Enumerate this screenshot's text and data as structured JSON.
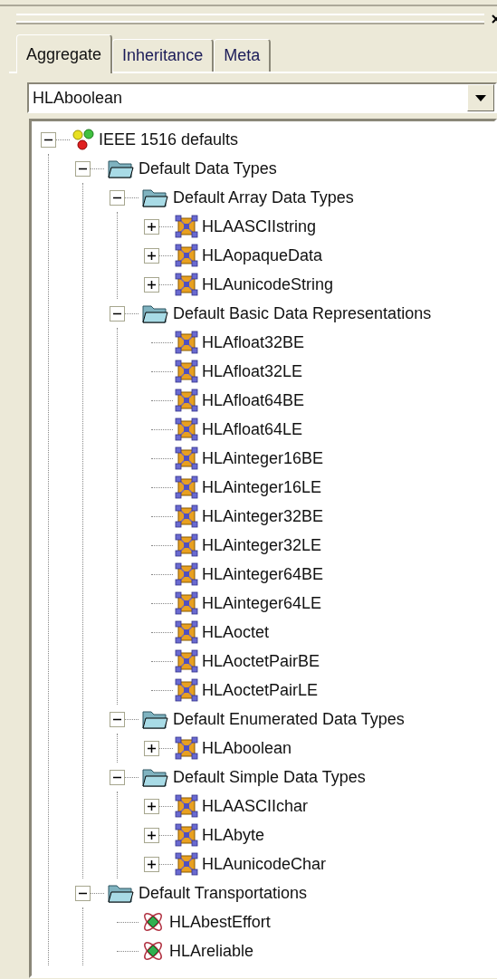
{
  "tabs": [
    {
      "label": "Aggregate",
      "selected": true
    },
    {
      "label": "Inheritance",
      "selected": false
    },
    {
      "label": "Meta",
      "selected": false
    }
  ],
  "dropdown": {
    "value": "HLAboolean"
  },
  "tree": [
    {
      "label": "IEEE 1516 defaults",
      "kind": "root",
      "expanded": true,
      "children": [
        {
          "label": "Default Data Types",
          "kind": "folder",
          "expanded": true,
          "children": [
            {
              "label": "Default Array Data Types",
              "kind": "folder",
              "expanded": true,
              "children": [
                {
                  "label": "HLAASCIIstring",
                  "kind": "datatype",
                  "expanded": false
                },
                {
                  "label": "HLAopaqueData",
                  "kind": "datatype",
                  "expanded": false
                },
                {
                  "label": "HLAunicodeString",
                  "kind": "datatype",
                  "expanded": false
                }
              ]
            },
            {
              "label": "Default Basic Data Representations",
              "kind": "folder",
              "expanded": true,
              "children": [
                {
                  "label": "HLAfloat32BE",
                  "kind": "datatype"
                },
                {
                  "label": "HLAfloat32LE",
                  "kind": "datatype"
                },
                {
                  "label": "HLAfloat64BE",
                  "kind": "datatype"
                },
                {
                  "label": "HLAfloat64LE",
                  "kind": "datatype"
                },
                {
                  "label": "HLAinteger16BE",
                  "kind": "datatype"
                },
                {
                  "label": "HLAinteger16LE",
                  "kind": "datatype"
                },
                {
                  "label": "HLAinteger32BE",
                  "kind": "datatype"
                },
                {
                  "label": "HLAinteger32LE",
                  "kind": "datatype"
                },
                {
                  "label": "HLAinteger64BE",
                  "kind": "datatype"
                },
                {
                  "label": "HLAinteger64LE",
                  "kind": "datatype"
                },
                {
                  "label": "HLAoctet",
                  "kind": "datatype"
                },
                {
                  "label": "HLAoctetPairBE",
                  "kind": "datatype"
                },
                {
                  "label": "HLAoctetPairLE",
                  "kind": "datatype"
                }
              ]
            },
            {
              "label": "Default Enumerated Data Types",
              "kind": "folder",
              "expanded": true,
              "children": [
                {
                  "label": "HLAboolean",
                  "kind": "datatype",
                  "expanded": false
                }
              ]
            },
            {
              "label": "Default Simple Data Types",
              "kind": "folder",
              "expanded": true,
              "children": [
                {
                  "label": "HLAASCIIchar",
                  "kind": "datatype",
                  "expanded": false
                },
                {
                  "label": "HLAbyte",
                  "kind": "datatype",
                  "expanded": false
                },
                {
                  "label": "HLAunicodeChar",
                  "kind": "datatype",
                  "expanded": false
                }
              ]
            }
          ]
        },
        {
          "label": "Default Transportations",
          "kind": "folder",
          "expanded": true,
          "children": [
            {
              "label": "HLAbestEffort",
              "kind": "transport"
            },
            {
              "label": "HLAreliable",
              "kind": "transport"
            }
          ]
        }
      ]
    }
  ]
}
